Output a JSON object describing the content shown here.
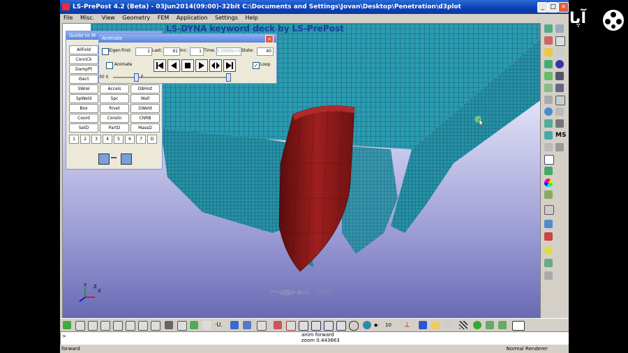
{
  "window": {
    "title": "LS-PrePost 4.2 (Beta) - 03Jun2014(09:00)-32bit C:\\Documents and Settings\\Jovan\\Desktop\\Penetration\\d3plot",
    "buttons": [
      "_",
      "□",
      "×"
    ]
  },
  "menu": [
    "File",
    "Misc.",
    "View",
    "Geometry",
    "FEM",
    "Application",
    "Settings",
    "Help"
  ],
  "viewport": {
    "overlay_text": "LS-DYNA keyword deck by LS-PrePost",
    "frame_counter": "10/61",
    "axis": {
      "y": "Y",
      "z": "Z",
      "x": "X"
    },
    "mesh_color": "#2a9bb1",
    "projectile_color": "#8b1a1a",
    "background_top": "#ffffff",
    "background_bottom": "#6a6ab4"
  },
  "guide_panel": {
    "title": "Guide to M",
    "buttons": [
      [
        "AllFold"
      ],
      [
        "ConnCk"
      ],
      [
        "DampPt"
      ],
      [
        "ISect"
      ],
      [
        "SWreI",
        "Accels",
        "DBHist"
      ],
      [
        "SpWeld",
        "Spc",
        "Wall"
      ],
      [
        "Box",
        "Rivet",
        "GWeld"
      ],
      [
        "Coord",
        "Constn",
        "CNRB"
      ],
      [
        "SetD",
        "PartD",
        "MassD"
      ]
    ],
    "page_numbers": [
      "1",
      "2",
      "3",
      "4",
      "5",
      "6",
      "7",
      "D"
    ],
    "bottom_icons": [
      "undo-icon",
      "redo-icon"
    ]
  },
  "animate_panel": {
    "title": "Animate",
    "eigen_label": "Eigen",
    "first_label": "First:",
    "first_value": "1",
    "last_label": "Last:",
    "last_value": "61",
    "inc_label": "Inc:",
    "inc_value": "1",
    "time_label": "Time:",
    "time_value": "1.0000e+05",
    "state_label": "State:",
    "state_value": "40",
    "animate_label": "Animate",
    "loop_label": "Loop",
    "loop_checked": true,
    "speed_label": "30 S",
    "speed_end": "F",
    "controls": [
      "first-frame-icon",
      "step-back-icon",
      "stop-icon",
      "play-icon",
      "bounce-icon",
      "last-frame-icon"
    ]
  },
  "bottom_toolbar_value": "10",
  "command": {
    "prompt": ">",
    "history_line1": "anim forward",
    "history_line2": "zoom 0.443663"
  },
  "status": {
    "left": "forward",
    "right": "Normal Renderer"
  },
  "watermark": "آپا"
}
